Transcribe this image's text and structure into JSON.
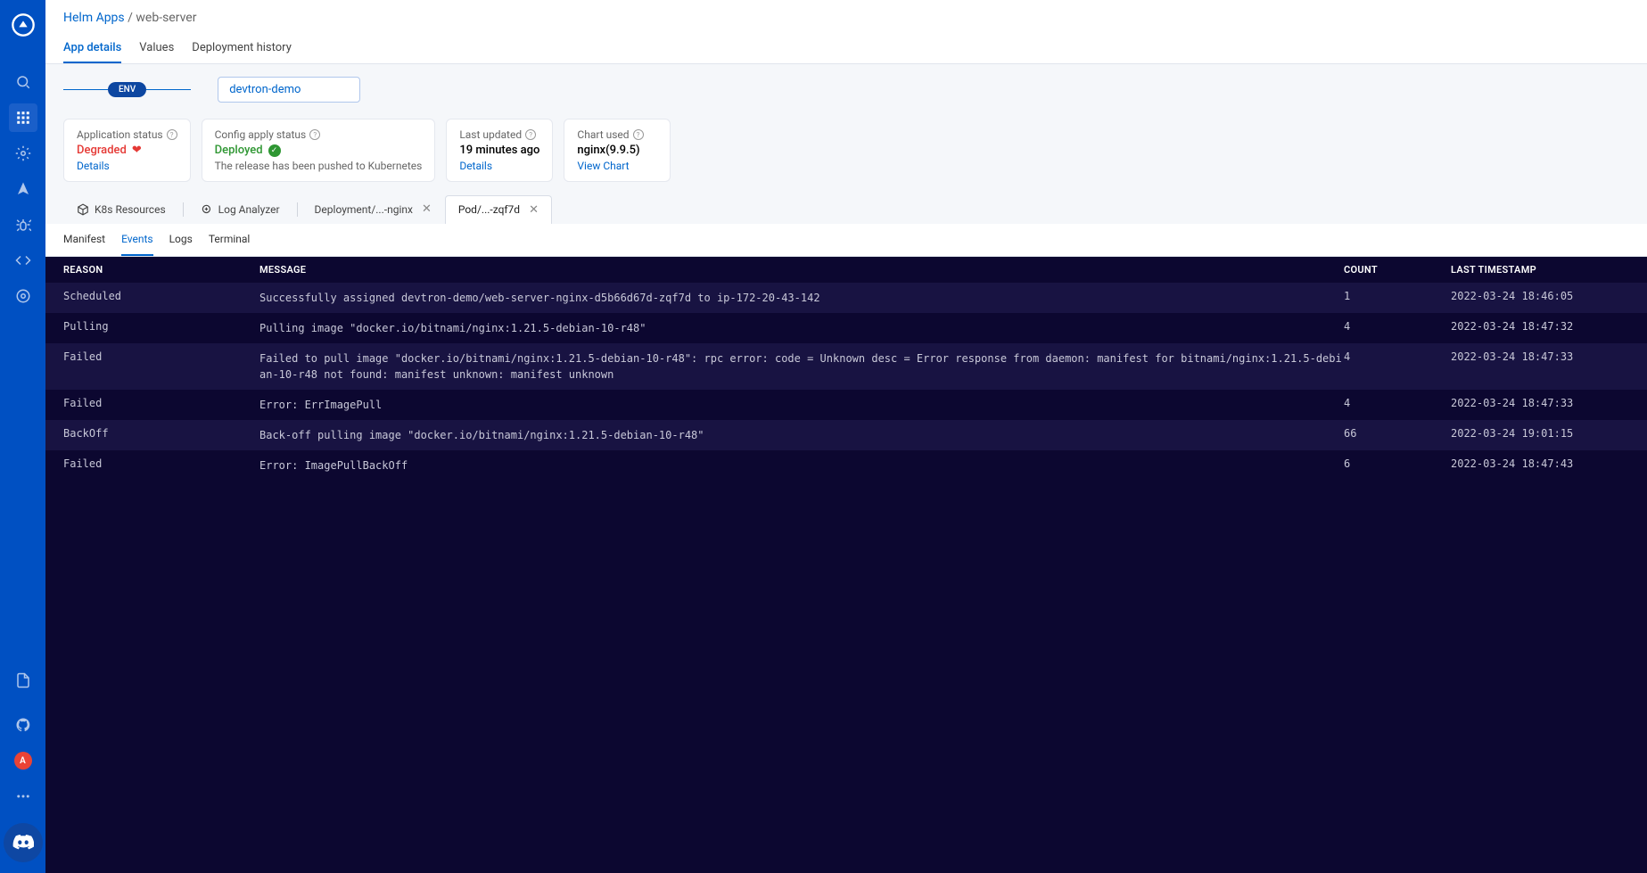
{
  "breadcrumb": {
    "root": "Helm Apps",
    "sep": " / ",
    "current": "web-server"
  },
  "top_tabs": {
    "app_details": "App details",
    "values": "Values",
    "deploy_history": "Deployment history"
  },
  "env": {
    "label": "ENV",
    "selected": "devtron-demo"
  },
  "cards": {
    "app_status": {
      "label": "Application status",
      "value": "Degraded",
      "link": "Details"
    },
    "config_status": {
      "label": "Config apply status",
      "value": "Deployed",
      "sub": "The release has been pushed to Kubernetes"
    },
    "last_updated": {
      "label": "Last updated",
      "value": "19 minutes ago",
      "link": "Details"
    },
    "chart_used": {
      "label": "Chart used",
      "value": "nginx(9.9.5)",
      "link": "View Chart"
    }
  },
  "res_tabs": {
    "k8s": "K8s Resources",
    "log_analyzer": "Log Analyzer",
    "deployment": "Deployment/...-nginx",
    "pod": "Pod/...-zqf7d"
  },
  "sub_tabs": {
    "manifest": "Manifest",
    "events": "Events",
    "logs": "Logs",
    "terminal": "Terminal"
  },
  "events": {
    "headers": {
      "reason": "REASON",
      "message": "MESSAGE",
      "count": "COUNT",
      "ts": "LAST TIMESTAMP"
    },
    "rows": [
      {
        "reason": "Scheduled",
        "message": "Successfully assigned devtron-demo/web-server-nginx-d5b66d67d-zqf7d to ip-172-20-43-142",
        "count": "1",
        "ts": "2022-03-24 18:46:05"
      },
      {
        "reason": "Pulling",
        "message": "Pulling image \"docker.io/bitnami/nginx:1.21.5-debian-10-r48\"",
        "count": "4",
        "ts": "2022-03-24 18:47:32"
      },
      {
        "reason": "Failed",
        "message": "Failed to pull image \"docker.io/bitnami/nginx:1.21.5-debian-10-r48\": rpc error: code = Unknown desc = Error response from daemon: manifest for bitnami/nginx:1.21.5-debian-10-r48 not found: manifest unknown: manifest unknown",
        "count": "4",
        "ts": "2022-03-24 18:47:33"
      },
      {
        "reason": "Failed",
        "message": "Error: ErrImagePull",
        "count": "4",
        "ts": "2022-03-24 18:47:33"
      },
      {
        "reason": "BackOff",
        "message": "Back-off pulling image \"docker.io/bitnami/nginx:1.21.5-debian-10-r48\"",
        "count": "66",
        "ts": "2022-03-24 19:01:15"
      },
      {
        "reason": "Failed",
        "message": "Error: ImagePullBackOff",
        "count": "6",
        "ts": "2022-03-24 18:47:43"
      }
    ]
  },
  "admin_initial": "A"
}
